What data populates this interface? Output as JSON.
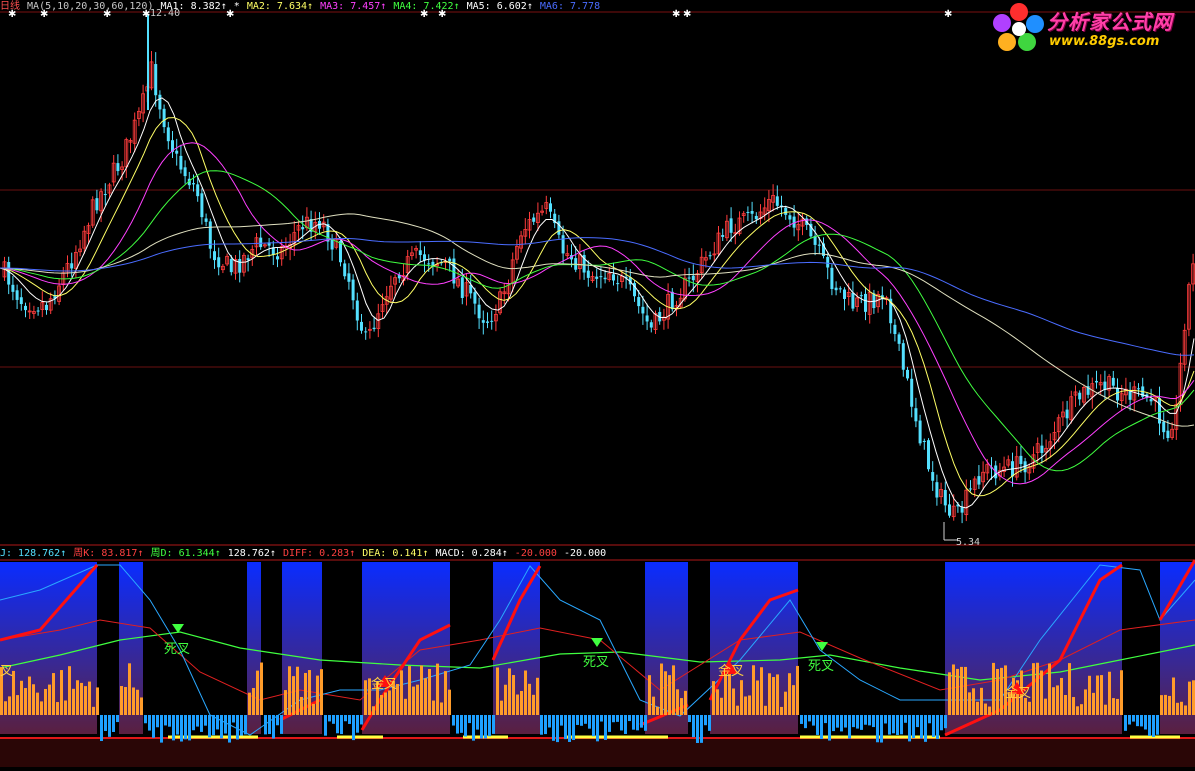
{
  "main_header": {
    "period": "日线",
    "ma_title": "MA(5,10,20,30,60,120)",
    "ma1": "MA1: 8.382↑",
    "ma2": "MA2: 7.634↑",
    "ma3": "MA3: 7.457↑",
    "ma4": "MA4: 7.422↑",
    "ma5": "MA5: 6.602↑",
    "ma6": "MA6: 7.778"
  },
  "sub_header": {
    "j": "J: 128.762↑",
    "zk": "周K: 83.817↑",
    "zd": "周D: 61.344↑",
    "v4": "128.762↑",
    "diff": "DIFF: 0.283↑",
    "dea": "DEA: 0.141↑",
    "macd": "MACD: 0.284↑",
    "v8": "-20.000",
    "v9": "-20.000"
  },
  "price_labels": {
    "high": "12.40",
    "low": "5.34"
  },
  "signals": {
    "death_cross": "死叉",
    "golden_cross": "金叉",
    "left_partial": "叉"
  },
  "logo": {
    "name": "分析家公式网",
    "url": "www.88gs.com"
  },
  "colors": {
    "background": "#000000",
    "up": "#ff3c3c",
    "down": "#54e0ff",
    "ma1": "#ffffff",
    "ma2": "#ffff66",
    "ma3": "#ff40ff",
    "ma4": "#40ff40",
    "ma5": "#4a6cff",
    "ma6": "#e0e0c0",
    "macd_pos": "#ff9c2a",
    "macd_neg": "#1ea0ff",
    "weekly_k": "#ff1010",
    "weekly_d": "#40ff40"
  },
  "icons": {
    "marker": "star-marker-icon",
    "death_arrow": "down-triangle-icon",
    "golden_arrow": "up-arrow-icon"
  }
}
